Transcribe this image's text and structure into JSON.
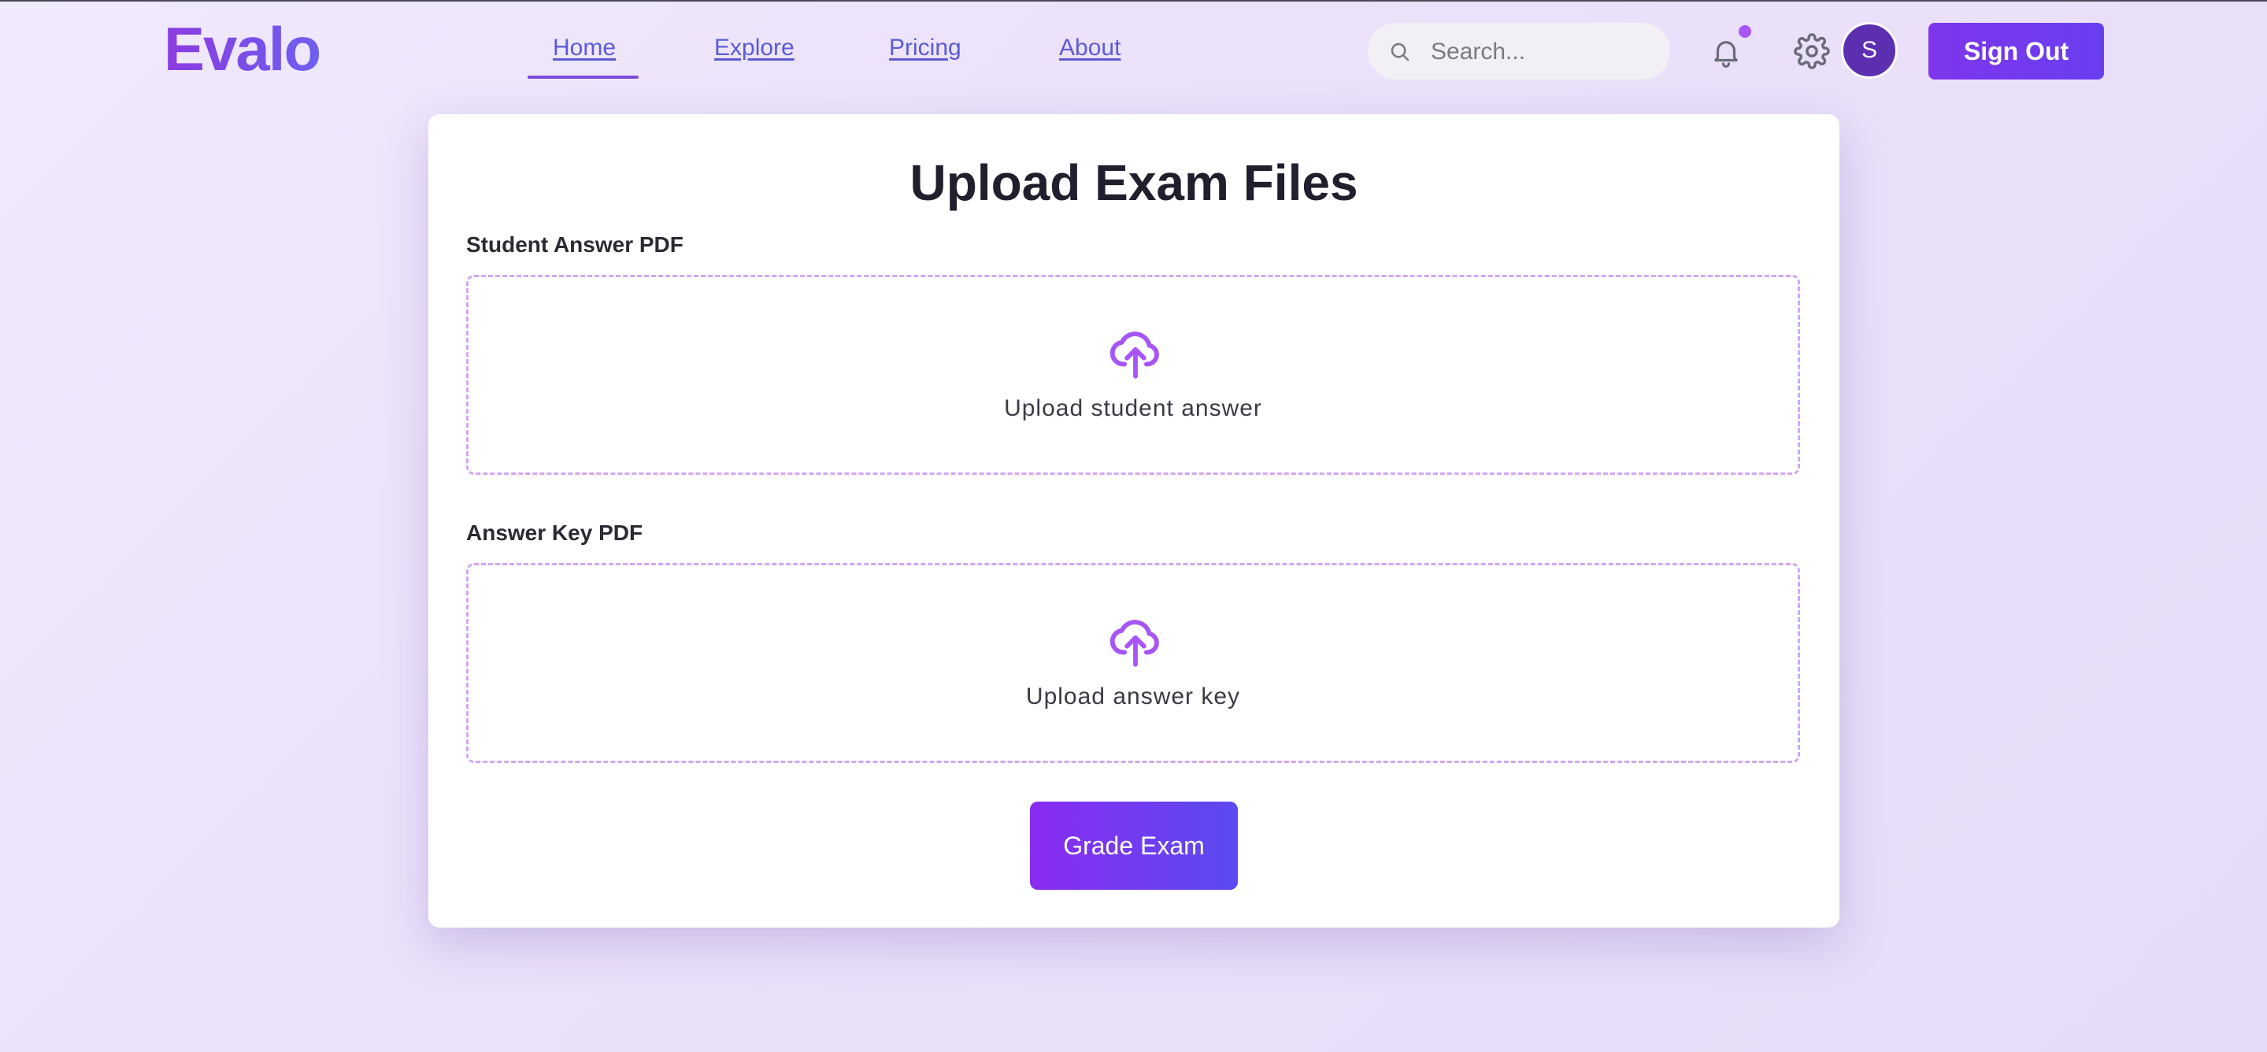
{
  "app": {
    "logo": "Evalo"
  },
  "nav": {
    "items": [
      {
        "label": "Home",
        "active": true
      },
      {
        "label": "Explore",
        "active": false
      },
      {
        "label": "Pricing",
        "active": false
      },
      {
        "label": "About",
        "active": false
      }
    ]
  },
  "search": {
    "placeholder": "Search..."
  },
  "user": {
    "avatar_initial": "S",
    "has_notification": true
  },
  "header_actions": {
    "sign_out_label": "Sign Out"
  },
  "main": {
    "title": "Upload Exam Files",
    "fields": [
      {
        "label": "Student Answer PDF",
        "dropzone_text": "Upload student answer"
      },
      {
        "label": "Answer Key PDF",
        "dropzone_text": "Upload answer key"
      }
    ],
    "submit_label": "Grade Exam"
  },
  "colors": {
    "accent": "#7e35ec",
    "accent_secondary": "#5b4af0",
    "nav_link": "#5b5bd6",
    "dropzone_border": "#d3a6f2",
    "notification_dot": "#a855f7"
  },
  "icons": [
    "search-icon",
    "bell-icon",
    "gear-icon",
    "cloud-upload-icon"
  ]
}
